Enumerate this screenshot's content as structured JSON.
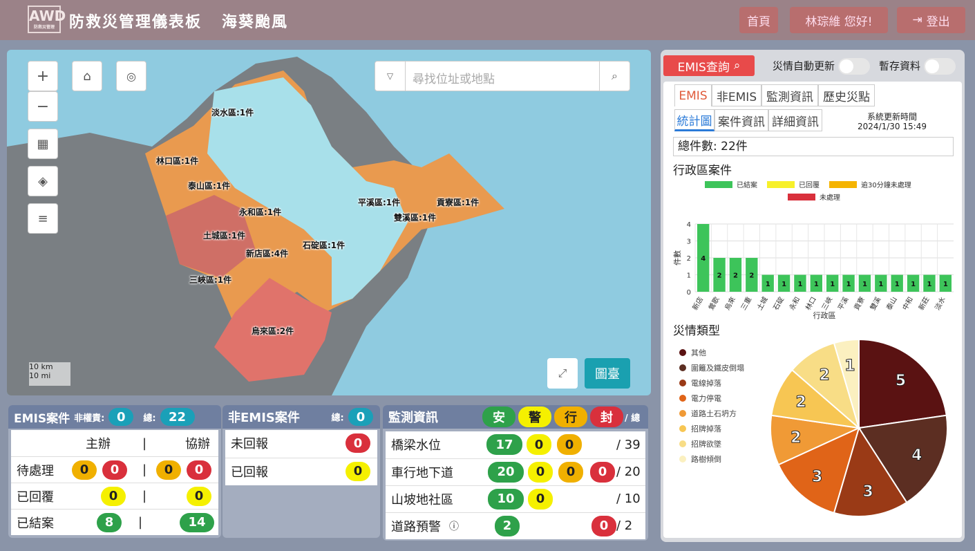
{
  "header": {
    "logo_text": "AWD",
    "title": "防救災管理儀表板",
    "event": "海葵颱風",
    "home": "首頁",
    "user": "林琮維 您好!",
    "logout": "登出"
  },
  "map": {
    "search_placeholder": "尋找位址或地點",
    "scale_km": "10 km",
    "scale_mi": "10 mi",
    "baseline_btn": "圖臺",
    "labels": [
      "淡水區:1件",
      "林口區:1件",
      "泰山區:1件",
      "永和區:1件",
      "平溪區:1件",
      "貢寮區:1件",
      "雙溪區:1件",
      "土城區:1件",
      "石碇區:1件",
      "新店區:4件",
      "三峽區:1件",
      "烏來區:2件"
    ]
  },
  "emis_panel": {
    "title": "EMIS案件",
    "unassigned_label": "非權責:",
    "unassigned": "0",
    "total_label": "總:",
    "total": "22",
    "col_main": "主辦",
    "col_sep": "|",
    "col_assist": "協辦",
    "rows": [
      {
        "label": "待處理",
        "m1": "0",
        "m2": "0",
        "a1": "0",
        "a2": "0"
      },
      {
        "label": "已回覆",
        "m": "0",
        "a": "0"
      },
      {
        "label": "已結案",
        "m": "8",
        "a": "14"
      }
    ]
  },
  "nonemis_panel": {
    "title": "非EMIS案件",
    "total_label": "總:",
    "total": "0",
    "rows": [
      {
        "label": "未回報",
        "value": "0"
      },
      {
        "label": "已回報",
        "value": "0"
      }
    ]
  },
  "monitor_panel": {
    "title": "監測資訊",
    "h_safe": "安",
    "h_warn": "警",
    "h_act": "行",
    "h_close": "封",
    "h_total": "/ 總",
    "rows": [
      {
        "label": "橋梁水位",
        "g": "17",
        "y": "0",
        "o": "0",
        "total": "/ 39"
      },
      {
        "label": "車行地下道",
        "g": "20",
        "y": "0",
        "o": "0",
        "r": "0",
        "total": "/ 20"
      },
      {
        "label": "山坡地社區",
        "g": "10",
        "y": "0",
        "total": "/ 10"
      },
      {
        "label": "道路預警",
        "g": "2",
        "r": "0",
        "total": "/  2"
      }
    ]
  },
  "right": {
    "emis_query": "EMIS查詢",
    "auto_update": "災情自動更新",
    "cache": "暫存資料",
    "tabs": [
      "EMIS",
      "非EMIS",
      "監測資訊",
      "歷史災點"
    ],
    "subtabs": [
      "統計圖",
      "案件資訊",
      "詳細資訊"
    ],
    "update_label": "系統更新時間",
    "update_time": "2024/1/30 15:49",
    "total_cases": "總件數: 22件",
    "bar_title": "行政區案件",
    "pie_title": "災情類型"
  },
  "chart_data": [
    {
      "type": "bar",
      "title": "行政區案件",
      "xlabel": "行政區",
      "ylabel": "件數",
      "ylim": [
        0,
        4
      ],
      "legend": [
        "已結案",
        "已回覆",
        "逾30分鐘未處理",
        "未處理"
      ],
      "categories": [
        "新店",
        "鶯歌",
        "烏來",
        "三重",
        "土城",
        "石碇",
        "永和",
        "林口",
        "三峽",
        "平溪",
        "貢寮",
        "雙溪",
        "泰山",
        "中和",
        "新莊",
        "淡水"
      ],
      "series": [
        {
          "name": "已結案",
          "values": [
            4,
            2,
            2,
            2,
            1,
            1,
            1,
            1,
            1,
            1,
            1,
            1,
            1,
            1,
            1,
            1
          ]
        }
      ],
      "yticks": [
        0,
        1,
        2,
        3,
        4
      ]
    },
    {
      "type": "pie",
      "title": "災情類型",
      "labels": [
        "其他",
        "圍籬及鐵皮倒塌",
        "電線掉落",
        "電力停電",
        "道路土石坍方",
        "招牌掉落",
        "招牌欲墜",
        "路樹傾倒"
      ],
      "values": [
        5,
        4,
        3,
        3,
        2,
        2,
        2,
        1
      ],
      "colors": [
        "#5a1212",
        "#5c2e22",
        "#9a3a16",
        "#e06418",
        "#f09a36",
        "#f7c653",
        "#f8dd86",
        "#fbf0c0"
      ]
    }
  ]
}
